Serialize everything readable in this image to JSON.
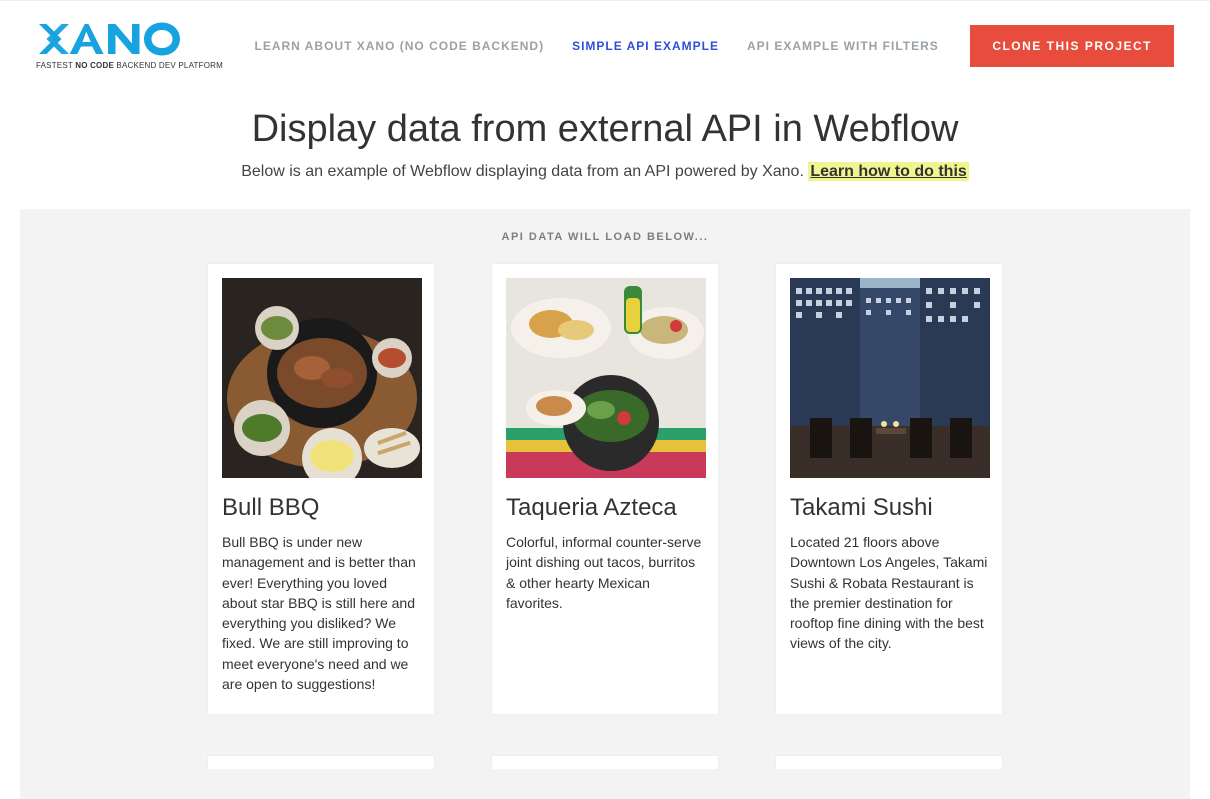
{
  "brand": {
    "name": "XANO",
    "tagline_prefix": "FASTEST ",
    "tagline_bold": "NO CODE",
    "tagline_suffix": " BACKEND DEV PLATFORM",
    "accent": "#17a2e0"
  },
  "nav": {
    "items": [
      {
        "label": "LEARN ABOUT XANO (NO CODE BACKEND)",
        "active": false
      },
      {
        "label": "SIMPLE API EXAMPLE",
        "active": true
      },
      {
        "label": "API EXAMPLE WITH FILTERS",
        "active": false
      }
    ]
  },
  "cta": {
    "clone_label": "CLONE THIS PROJECT"
  },
  "hero": {
    "title": "Display data from external API in Webflow",
    "intro": "Below is an example of Webflow displaying data from an API powered by Xano. ",
    "learn_label": "Learn how to do this"
  },
  "section": {
    "subhead": "API DATA WILL LOAD BELOW..."
  },
  "cards": [
    {
      "title": "Bull BBQ",
      "desc": "Bull BBQ is under new management and is better than ever! Everything you loved about star BBQ is still here and everything you disliked? We fixed. We are still improving to meet everyone's need and we are open to suggestions!"
    },
    {
      "title": "Taqueria Azteca",
      "desc": "Colorful, informal counter-serve joint dishing out tacos, burritos & other hearty Mexican favorites."
    },
    {
      "title": "Takami Sushi",
      "desc": "Located 21 floors above Downtown Los Angeles, Takami Sushi & Robata Restaurant is the premier destination for rooftop fine dining with the best views of the city."
    }
  ]
}
